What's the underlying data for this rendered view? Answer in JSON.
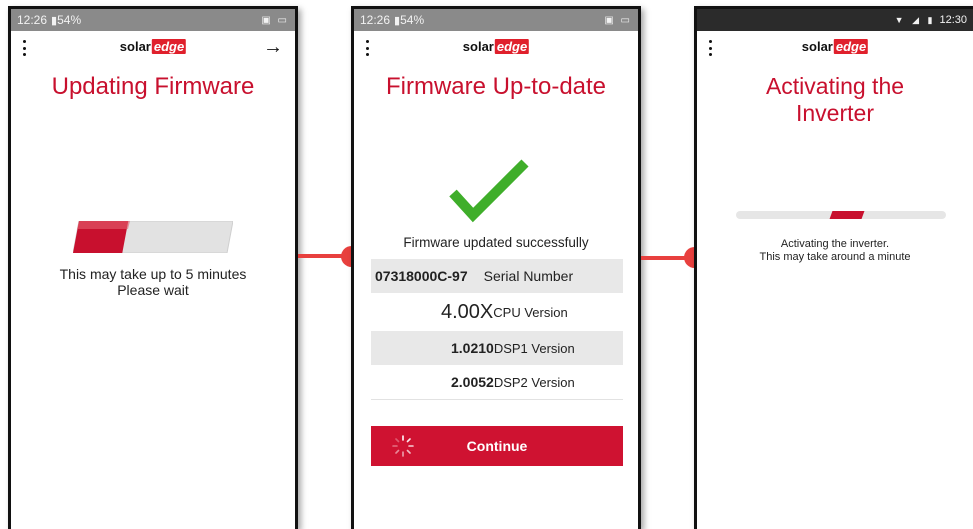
{
  "screen1": {
    "status_time": "12:26",
    "status_battery": "54%",
    "status_icons_right": "▣ ▭",
    "logo_solar": "solar",
    "logo_edge": "edge",
    "title": "Updating Firmware",
    "progress": 0.32,
    "message_line1": "This may take up to 5 minutes",
    "message_line2": "Please wait"
  },
  "screen2": {
    "status_time": "12:26",
    "status_battery": "54%",
    "status_icons_right": "▣ ▭",
    "logo_solar": "solar",
    "logo_edge": "edge",
    "title": "Firmware Up-to-date",
    "success_message": "Firmware updated successfully",
    "rows": [
      {
        "value": "07318000C-97",
        "label": "Serial Number"
      },
      {
        "value": "4.00X",
        "label": "CPU Version"
      },
      {
        "value": "1.0210",
        "label": "DSP1 Version"
      },
      {
        "value": "2.0052",
        "label": "DSP2 Version"
      }
    ],
    "continue_label": "Continue"
  },
  "screen3": {
    "status_time": "12:30",
    "status_icons": "▼ ◢ ▮",
    "logo_solar": "solar",
    "logo_edge": "edge",
    "title_line1": "Activating the",
    "title_line2": "Inverter",
    "message_line1": "Activating the inverter.",
    "message_line2": "This may take around a minute"
  },
  "colors": {
    "brand_red": "#c8102e",
    "connector": "#e8403e",
    "check_green": "#3fae2a"
  }
}
